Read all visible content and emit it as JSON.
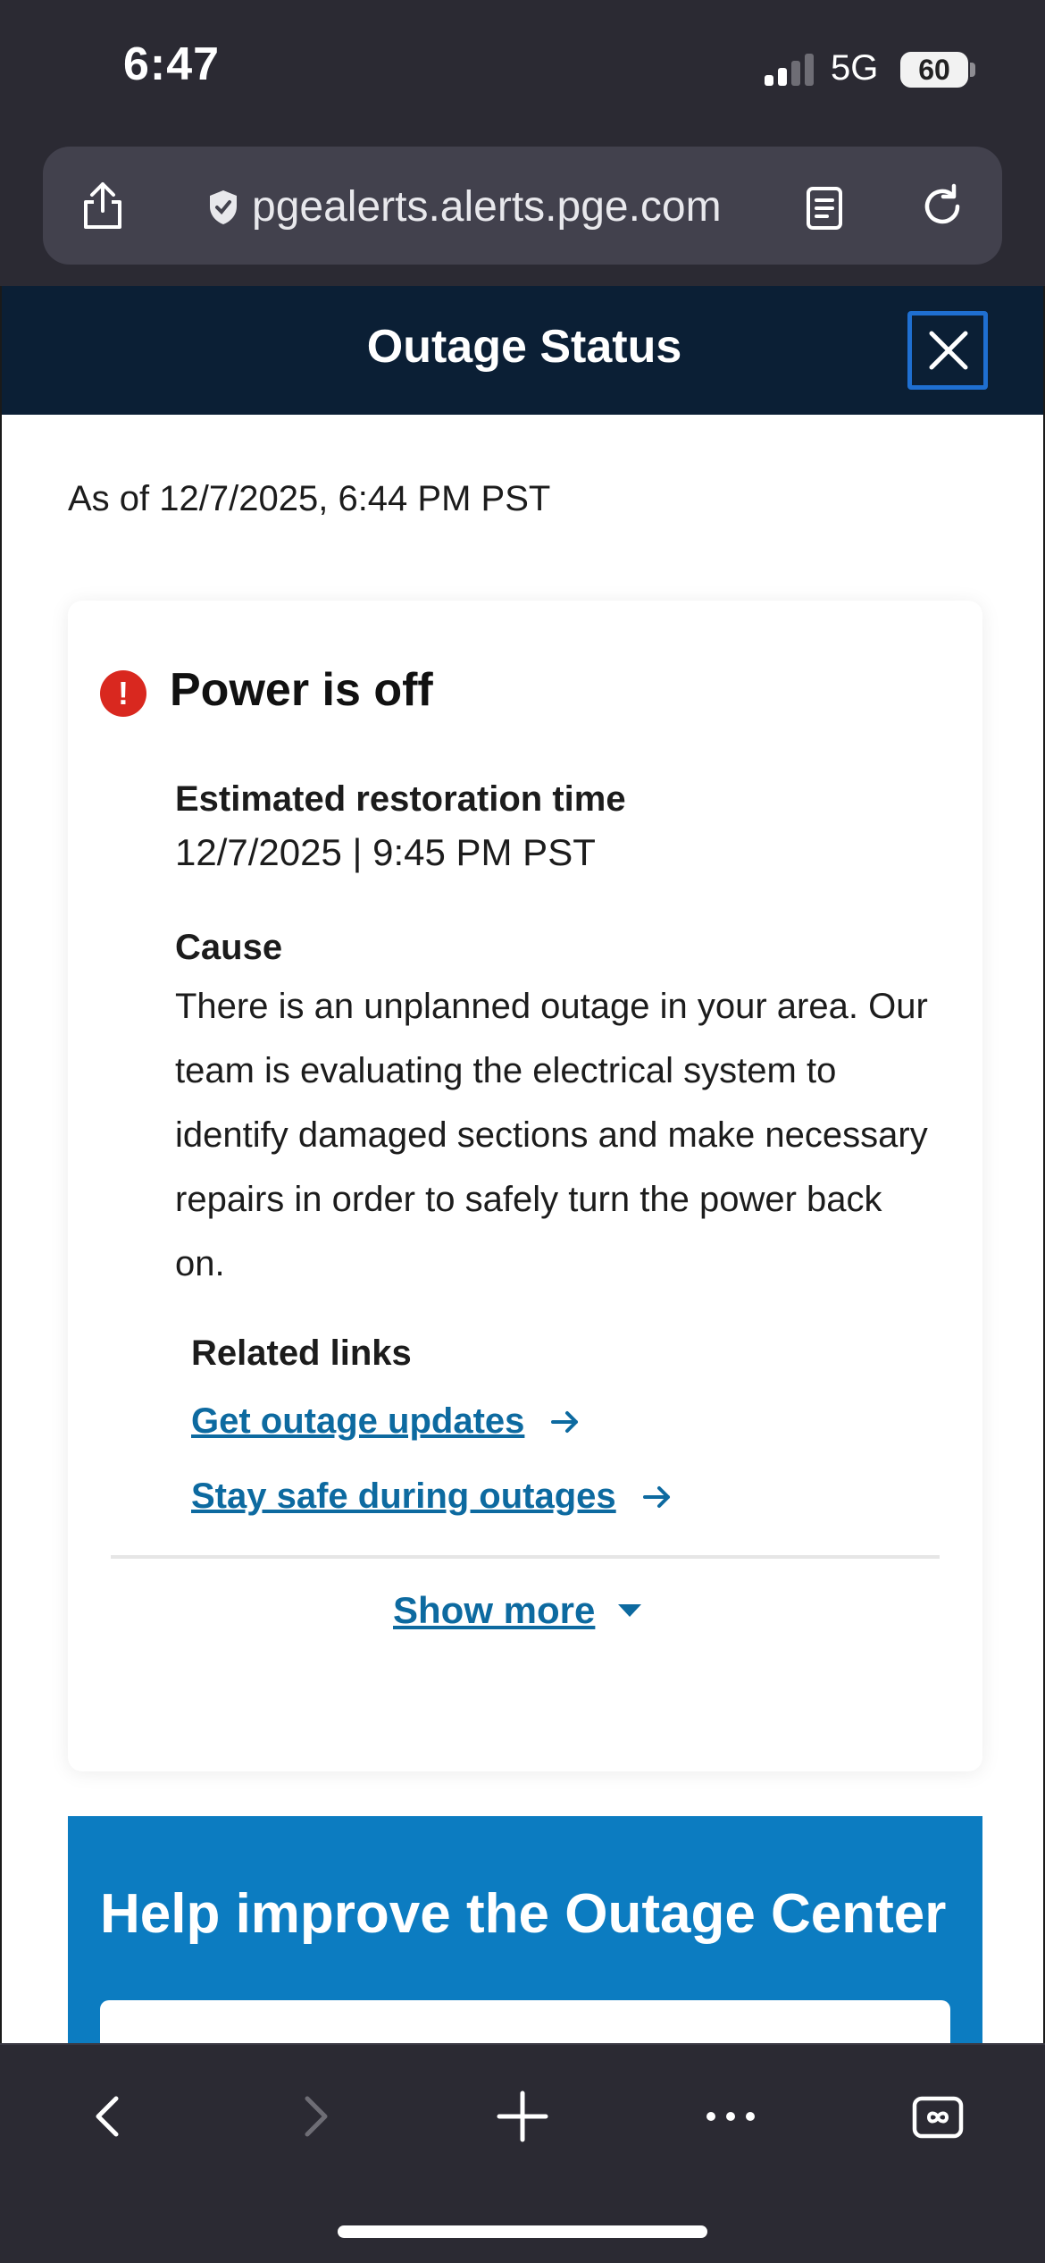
{
  "status_bar": {
    "time": "6:47",
    "network": "5G",
    "battery": "60"
  },
  "browser": {
    "url": "pgealerts.alerts.pge.com"
  },
  "header": {
    "title": "Outage Status"
  },
  "as_of": "As of 12/7/2025, 6:44 PM PST",
  "status": {
    "title": "Power is off",
    "restoration_label": "Estimated restoration time",
    "restoration_value": "12/7/2025 | 9:45 PM PST",
    "cause_label": "Cause",
    "cause_text": "There is an unplanned outage in your area. Our team is evaluating the electrical system to identify damaged sections and make necessary repairs in order to safely turn the power back on.",
    "links_label": "Related links",
    "links": [
      {
        "label": "Get outage updates"
      },
      {
        "label": "Stay safe during outages"
      }
    ],
    "show_more": "Show more"
  },
  "help": {
    "title": "Help improve the Outage Center"
  },
  "colors": {
    "header_bg": "#0b1f35",
    "link": "#0d6aa0",
    "alert": "#d9281f",
    "banner": "#0c7cc1"
  },
  "icons": [
    "share-icon",
    "shield-icon",
    "reader-icon",
    "reload-icon",
    "close-icon",
    "alert-icon",
    "arrow-right-icon",
    "caret-down-icon",
    "back-icon",
    "forward-icon",
    "new-tab-icon",
    "more-icon",
    "tabs-icon"
  ]
}
